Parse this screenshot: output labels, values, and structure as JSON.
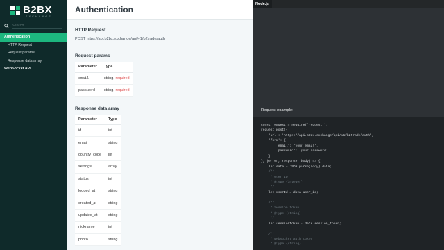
{
  "brand": {
    "name": "B2BX",
    "sub": "EXCHANGE",
    "color": "#1db77f"
  },
  "search": {
    "placeholder": "Search"
  },
  "nav": {
    "active": "Authentication",
    "subitems": [
      "HTTP Request",
      "Request params",
      "Response data array"
    ],
    "next": "WebSocket API"
  },
  "page": {
    "title": "Authentication",
    "http_heading": "HTTP Request",
    "request_line": "POST https://api.b2bx.exchange/api/v1/b2trade/auth",
    "params_heading": "Request params",
    "params_headers": [
      "Parameter",
      "Type"
    ],
    "params": [
      {
        "name": "email",
        "type": "string",
        "req": "required"
      },
      {
        "name": "password",
        "type": "string",
        "req": "required"
      }
    ],
    "response_heading": "Response data array",
    "response_headers": [
      "Parameter",
      "Type"
    ],
    "response": [
      {
        "name": "id",
        "type": "int"
      },
      {
        "name": "email",
        "type": "string"
      },
      {
        "name": "country_code",
        "type": "int"
      },
      {
        "name": "settings",
        "type": "array"
      },
      {
        "name": "status",
        "type": "int"
      },
      {
        "name": "logged_at",
        "type": "string"
      },
      {
        "name": "created_at",
        "type": "string"
      },
      {
        "name": "updated_at",
        "type": "string"
      },
      {
        "name": "nickname",
        "type": "int"
      },
      {
        "name": "photo",
        "type": "string"
      }
    ]
  },
  "code": {
    "tab": "Node.js",
    "example_label": "Request example:",
    "lines": [
      "const request = require('request');",
      "request.post({",
      "    'url': 'https://api.b2bx.exchange/api/v1/b2trade/auth',",
      "    'form': {",
      "        'email': 'your email',",
      "        'password': 'your password'",
      "    }",
      "}, (error, response, body) => {",
      "    let data = JSON.parse(body).data;",
      "    /**",
      "     * User ID",
      "     * @type {integer}",
      "     */",
      "    let userId = data.user_id;",
      "",
      "    /**",
      "     * Session token",
      "     * @type {string}",
      "     */",
      "    let sessionToken = data.session_token;",
      "",
      "    /**",
      "     * Websocket auth token",
      "     * @type {string}"
    ]
  }
}
